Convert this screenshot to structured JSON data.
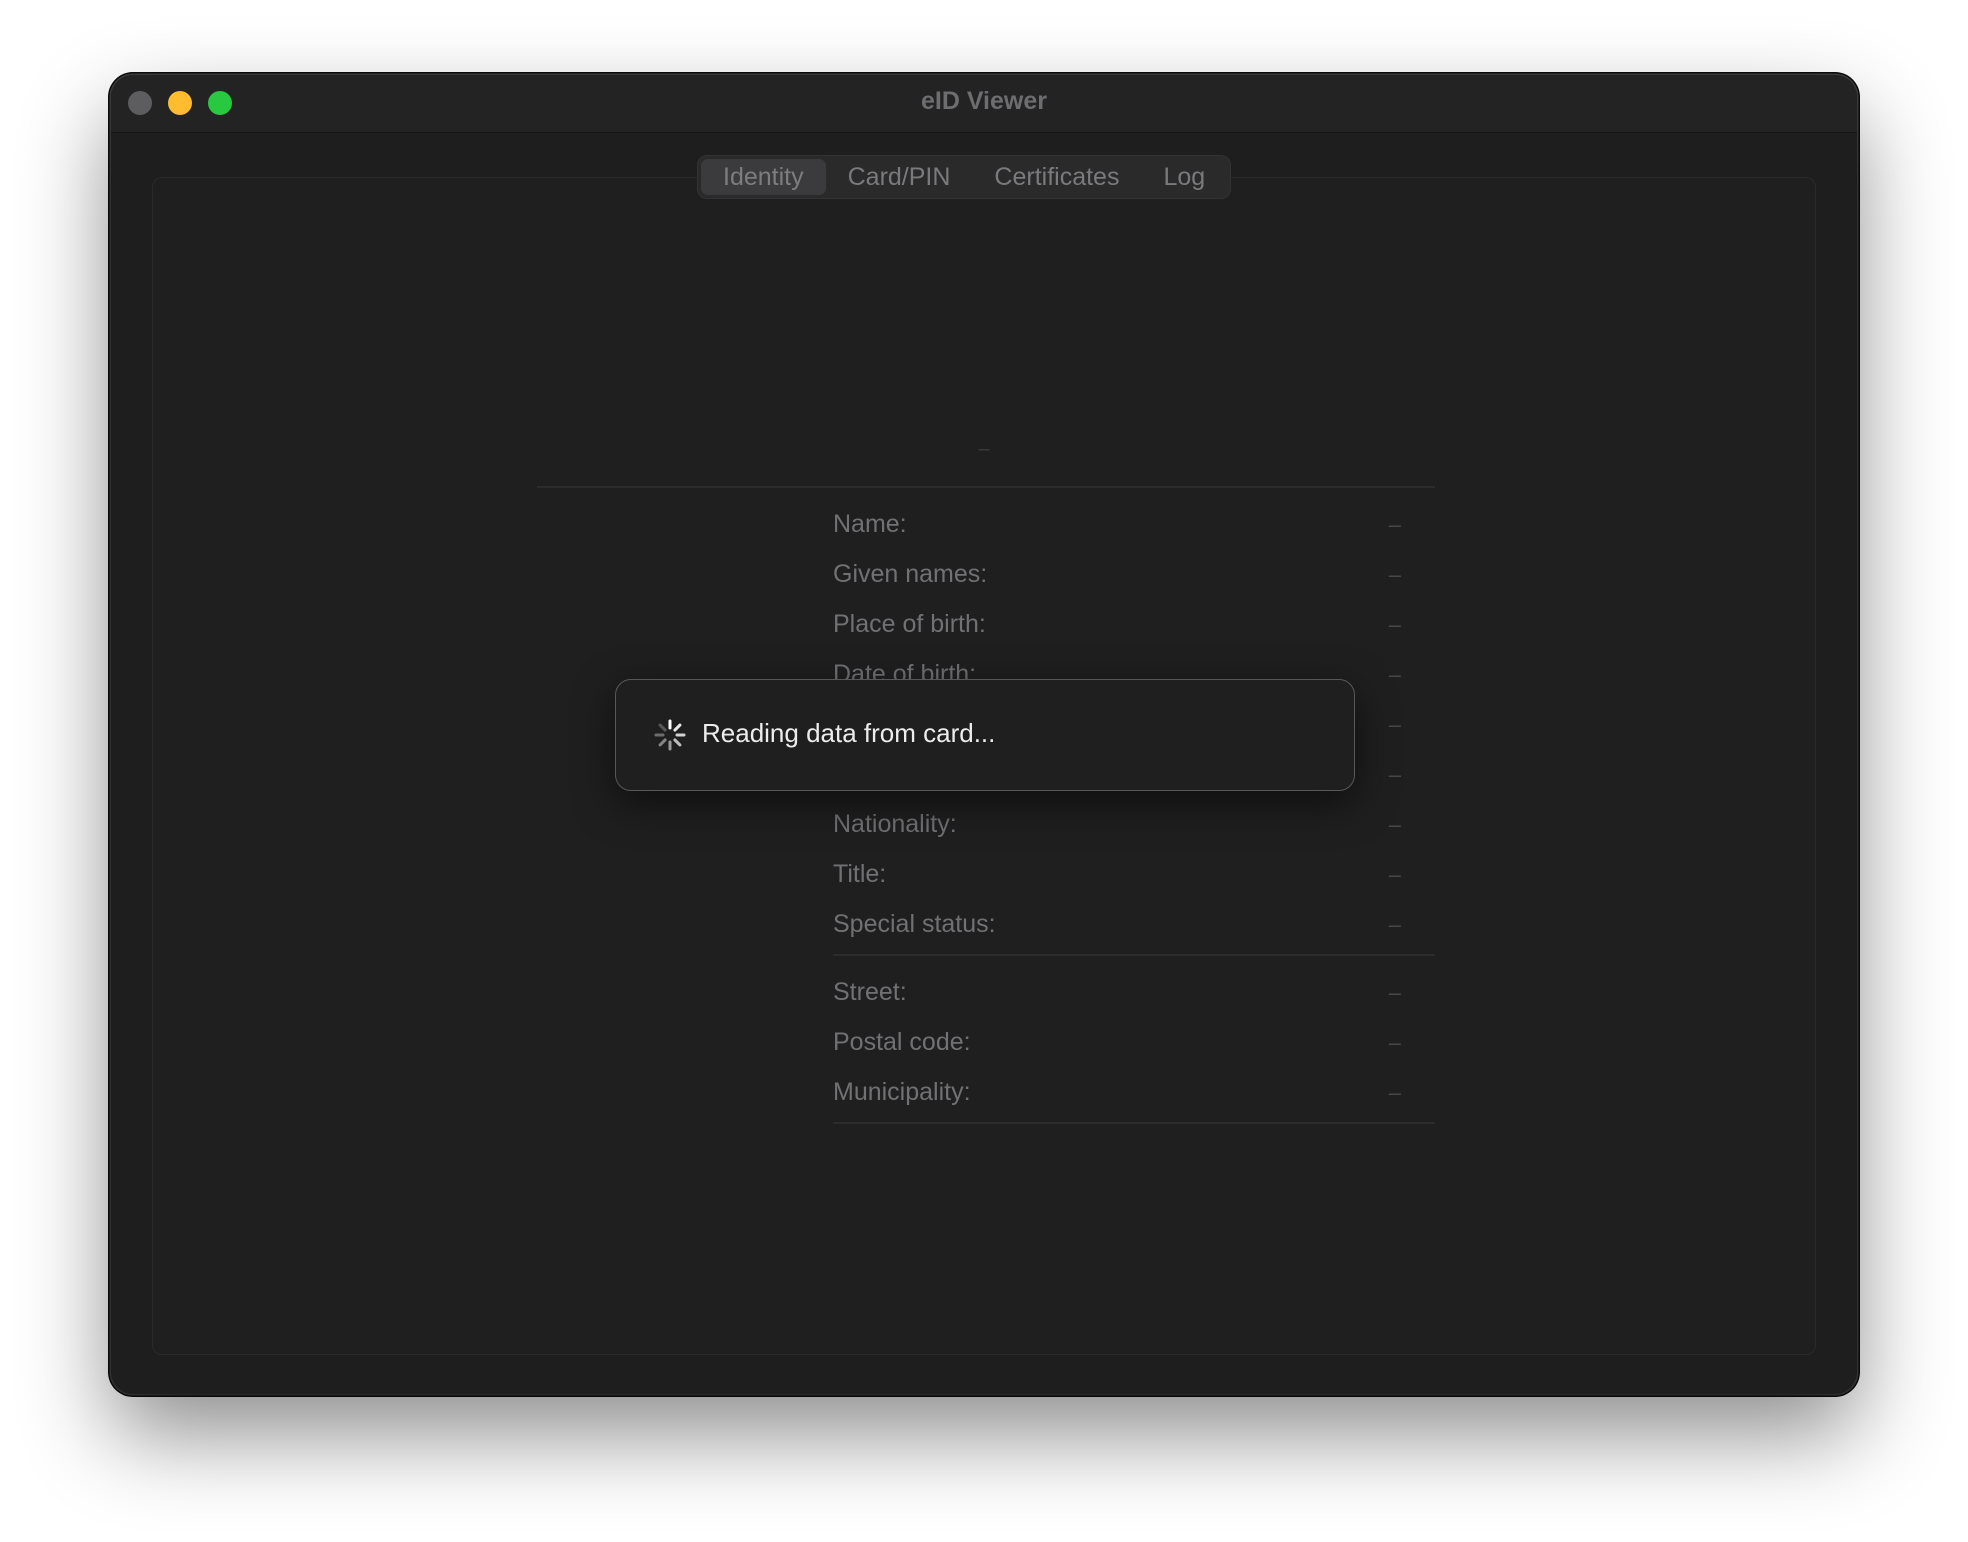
{
  "window": {
    "title": "eID Viewer"
  },
  "tabs": [
    {
      "label": "Identity",
      "active": true
    },
    {
      "label": "Card/PIN",
      "active": false
    },
    {
      "label": "Certificates",
      "active": false
    },
    {
      "label": "Log",
      "active": false
    }
  ],
  "identity": {
    "photo_placeholder": "–",
    "fields": [
      {
        "label": "Name:",
        "value": "–"
      },
      {
        "label": "Given names:",
        "value": "–"
      },
      {
        "label": "Place of birth:",
        "value": "–"
      },
      {
        "label": "Date of birth:",
        "value": "–"
      },
      {
        "label": "",
        "value": "–"
      },
      {
        "label": "",
        "value": "–"
      },
      {
        "label": "Nationality:",
        "value": "–"
      },
      {
        "label": "Title:",
        "value": "–"
      },
      {
        "label": "Special status:",
        "value": "–"
      }
    ],
    "address": [
      {
        "label": "Street:",
        "value": "–"
      },
      {
        "label": "Postal code:",
        "value": "–"
      },
      {
        "label": "Municipality:",
        "value": "–"
      }
    ]
  },
  "dialog": {
    "message": "Reading data from card...",
    "icon": "spinner-icon"
  },
  "colors": {
    "close": "#5d5d5f",
    "minimize": "#febc2e",
    "maximize": "#28c840",
    "background": "#1e1e1f"
  }
}
